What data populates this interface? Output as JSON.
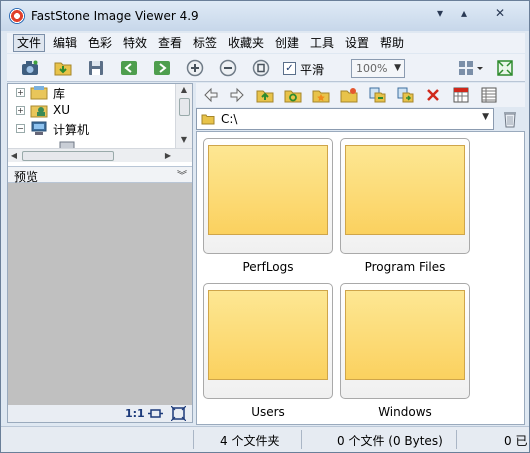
{
  "window": {
    "title": "FastStone Image Viewer 4.9"
  },
  "menu": {
    "items": [
      "文件",
      "编辑",
      "色彩",
      "特效",
      "查看",
      "标签",
      "收藏夹",
      "创建",
      "工具",
      "设置",
      "帮助"
    ]
  },
  "toolbar": {
    "smooth_label": "平滑",
    "smooth_checked": true,
    "zoom_value": "100%"
  },
  "tree": {
    "items": [
      {
        "label": "库",
        "icon": "library-icon"
      },
      {
        "label": "XU",
        "icon": "user-folder-icon"
      },
      {
        "label": "计算机",
        "icon": "computer-icon"
      }
    ]
  },
  "preview": {
    "label": "预览",
    "ratio": "1:1"
  },
  "path": {
    "value": "C:\\"
  },
  "thumbnails": [
    {
      "label": "PerfLogs"
    },
    {
      "label": "Program Files"
    },
    {
      "label": "Users"
    },
    {
      "label": "Windows"
    }
  ],
  "status": {
    "folders": "4 个文件夹",
    "files": "0 个文件 (0 Bytes)",
    "selected": "0 已"
  },
  "colors": {
    "folder_fill": "#fbd15f",
    "accent": "#2f6db5",
    "delete": "#d0281b"
  }
}
